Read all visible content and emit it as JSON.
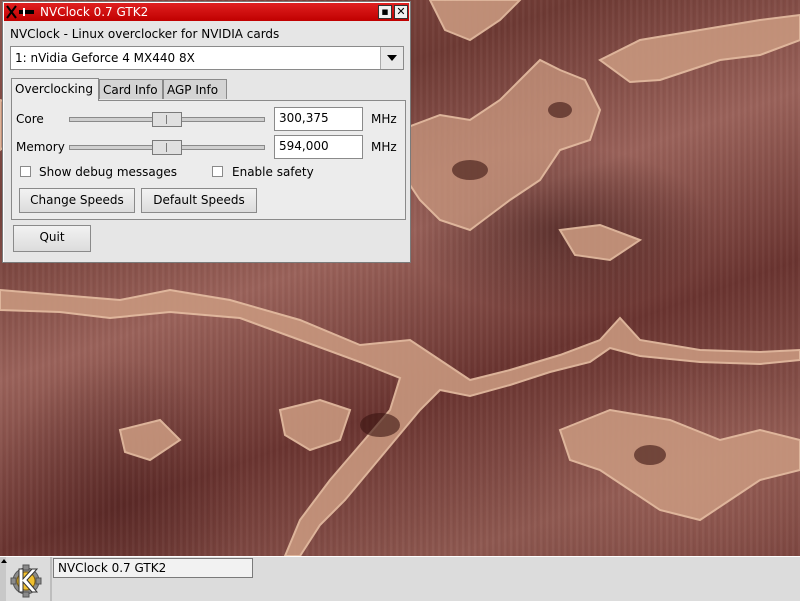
{
  "window": {
    "title": "NVClock 0.7 GTK2",
    "iconify_symbol": "▪",
    "close_symbol": "✕",
    "title_icon": "nvclock-app-icon"
  },
  "header": {
    "subtitle": "NVClock - Linux overclocker for NVIDIA cards"
  },
  "card_select": {
    "selected": "1: nVidia Geforce 4 MX440 8X"
  },
  "tabs": [
    {
      "label": "Overclocking",
      "active": true
    },
    {
      "label": "Card Info",
      "active": false
    },
    {
      "label": "AGP Info",
      "active": false
    }
  ],
  "overclocking": {
    "core": {
      "label": "Core",
      "value": "300,375",
      "unit": "MHz"
    },
    "memory": {
      "label": "Memory",
      "value": "594,000",
      "unit": "MHz"
    },
    "show_debug": {
      "label": "Show debug messages",
      "checked": false
    },
    "enable_safety": {
      "label": "Enable safety",
      "checked": false
    },
    "change_speeds_label": "Change Speeds",
    "default_speeds_label": "Default Speeds"
  },
  "quit_label": "Quit",
  "taskbar": {
    "k_menu_icon": "kde-k-menu-icon",
    "task_label": "NVClock 0.7 GTK2"
  },
  "colors": {
    "titlebar": "#c00000",
    "window_bg": "#e6e6e6",
    "wallpaper": "#7a443e"
  }
}
